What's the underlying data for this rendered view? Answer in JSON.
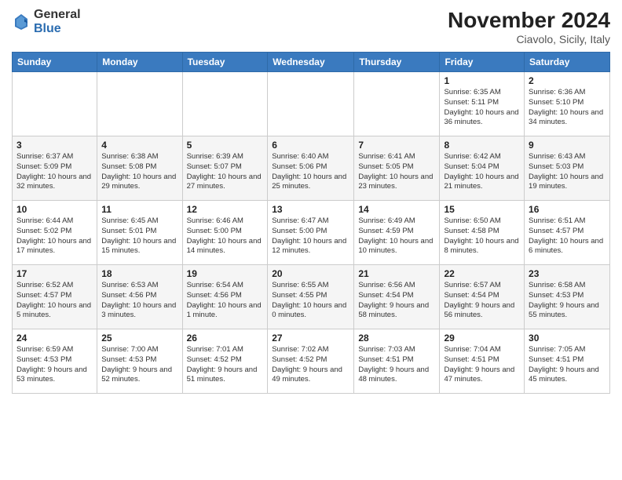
{
  "logo": {
    "general": "General",
    "blue": "Blue"
  },
  "header": {
    "title": "November 2024",
    "location": "Ciavolo, Sicily, Italy"
  },
  "weekdays": [
    "Sunday",
    "Monday",
    "Tuesday",
    "Wednesday",
    "Thursday",
    "Friday",
    "Saturday"
  ],
  "weeks": [
    [
      null,
      null,
      null,
      null,
      null,
      {
        "day": "1",
        "sunrise": "Sunrise: 6:35 AM",
        "sunset": "Sunset: 5:11 PM",
        "daylight": "Daylight: 10 hours and 36 minutes."
      },
      {
        "day": "2",
        "sunrise": "Sunrise: 6:36 AM",
        "sunset": "Sunset: 5:10 PM",
        "daylight": "Daylight: 10 hours and 34 minutes."
      }
    ],
    [
      {
        "day": "3",
        "sunrise": "Sunrise: 6:37 AM",
        "sunset": "Sunset: 5:09 PM",
        "daylight": "Daylight: 10 hours and 32 minutes."
      },
      {
        "day": "4",
        "sunrise": "Sunrise: 6:38 AM",
        "sunset": "Sunset: 5:08 PM",
        "daylight": "Daylight: 10 hours and 29 minutes."
      },
      {
        "day": "5",
        "sunrise": "Sunrise: 6:39 AM",
        "sunset": "Sunset: 5:07 PM",
        "daylight": "Daylight: 10 hours and 27 minutes."
      },
      {
        "day": "6",
        "sunrise": "Sunrise: 6:40 AM",
        "sunset": "Sunset: 5:06 PM",
        "daylight": "Daylight: 10 hours and 25 minutes."
      },
      {
        "day": "7",
        "sunrise": "Sunrise: 6:41 AM",
        "sunset": "Sunset: 5:05 PM",
        "daylight": "Daylight: 10 hours and 23 minutes."
      },
      {
        "day": "8",
        "sunrise": "Sunrise: 6:42 AM",
        "sunset": "Sunset: 5:04 PM",
        "daylight": "Daylight: 10 hours and 21 minutes."
      },
      {
        "day": "9",
        "sunrise": "Sunrise: 6:43 AM",
        "sunset": "Sunset: 5:03 PM",
        "daylight": "Daylight: 10 hours and 19 minutes."
      }
    ],
    [
      {
        "day": "10",
        "sunrise": "Sunrise: 6:44 AM",
        "sunset": "Sunset: 5:02 PM",
        "daylight": "Daylight: 10 hours and 17 minutes."
      },
      {
        "day": "11",
        "sunrise": "Sunrise: 6:45 AM",
        "sunset": "Sunset: 5:01 PM",
        "daylight": "Daylight: 10 hours and 15 minutes."
      },
      {
        "day": "12",
        "sunrise": "Sunrise: 6:46 AM",
        "sunset": "Sunset: 5:00 PM",
        "daylight": "Daylight: 10 hours and 14 minutes."
      },
      {
        "day": "13",
        "sunrise": "Sunrise: 6:47 AM",
        "sunset": "Sunset: 5:00 PM",
        "daylight": "Daylight: 10 hours and 12 minutes."
      },
      {
        "day": "14",
        "sunrise": "Sunrise: 6:49 AM",
        "sunset": "Sunset: 4:59 PM",
        "daylight": "Daylight: 10 hours and 10 minutes."
      },
      {
        "day": "15",
        "sunrise": "Sunrise: 6:50 AM",
        "sunset": "Sunset: 4:58 PM",
        "daylight": "Daylight: 10 hours and 8 minutes."
      },
      {
        "day": "16",
        "sunrise": "Sunrise: 6:51 AM",
        "sunset": "Sunset: 4:57 PM",
        "daylight": "Daylight: 10 hours and 6 minutes."
      }
    ],
    [
      {
        "day": "17",
        "sunrise": "Sunrise: 6:52 AM",
        "sunset": "Sunset: 4:57 PM",
        "daylight": "Daylight: 10 hours and 5 minutes."
      },
      {
        "day": "18",
        "sunrise": "Sunrise: 6:53 AM",
        "sunset": "Sunset: 4:56 PM",
        "daylight": "Daylight: 10 hours and 3 minutes."
      },
      {
        "day": "19",
        "sunrise": "Sunrise: 6:54 AM",
        "sunset": "Sunset: 4:56 PM",
        "daylight": "Daylight: 10 hours and 1 minute."
      },
      {
        "day": "20",
        "sunrise": "Sunrise: 6:55 AM",
        "sunset": "Sunset: 4:55 PM",
        "daylight": "Daylight: 10 hours and 0 minutes."
      },
      {
        "day": "21",
        "sunrise": "Sunrise: 6:56 AM",
        "sunset": "Sunset: 4:54 PM",
        "daylight": "Daylight: 9 hours and 58 minutes."
      },
      {
        "day": "22",
        "sunrise": "Sunrise: 6:57 AM",
        "sunset": "Sunset: 4:54 PM",
        "daylight": "Daylight: 9 hours and 56 minutes."
      },
      {
        "day": "23",
        "sunrise": "Sunrise: 6:58 AM",
        "sunset": "Sunset: 4:53 PM",
        "daylight": "Daylight: 9 hours and 55 minutes."
      }
    ],
    [
      {
        "day": "24",
        "sunrise": "Sunrise: 6:59 AM",
        "sunset": "Sunset: 4:53 PM",
        "daylight": "Daylight: 9 hours and 53 minutes."
      },
      {
        "day": "25",
        "sunrise": "Sunrise: 7:00 AM",
        "sunset": "Sunset: 4:53 PM",
        "daylight": "Daylight: 9 hours and 52 minutes."
      },
      {
        "day": "26",
        "sunrise": "Sunrise: 7:01 AM",
        "sunset": "Sunset: 4:52 PM",
        "daylight": "Daylight: 9 hours and 51 minutes."
      },
      {
        "day": "27",
        "sunrise": "Sunrise: 7:02 AM",
        "sunset": "Sunset: 4:52 PM",
        "daylight": "Daylight: 9 hours and 49 minutes."
      },
      {
        "day": "28",
        "sunrise": "Sunrise: 7:03 AM",
        "sunset": "Sunset: 4:51 PM",
        "daylight": "Daylight: 9 hours and 48 minutes."
      },
      {
        "day": "29",
        "sunrise": "Sunrise: 7:04 AM",
        "sunset": "Sunset: 4:51 PM",
        "daylight": "Daylight: 9 hours and 47 minutes."
      },
      {
        "day": "30",
        "sunrise": "Sunrise: 7:05 AM",
        "sunset": "Sunset: 4:51 PM",
        "daylight": "Daylight: 9 hours and 45 minutes."
      }
    ]
  ]
}
